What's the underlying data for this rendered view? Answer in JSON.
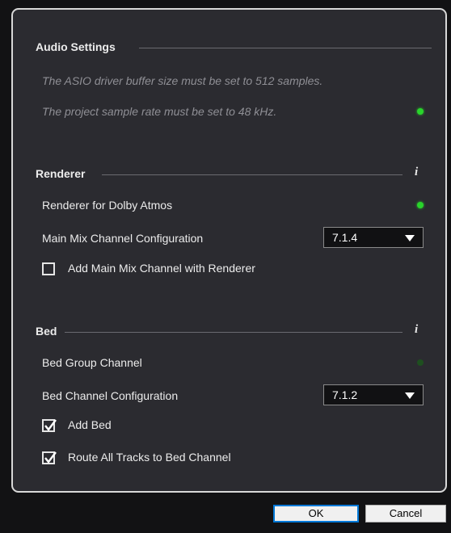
{
  "audio_settings": {
    "title": "Audio Settings",
    "note_buffer": "The ASIO driver buffer size must be set to 512 samples.",
    "note_sample_rate": "The project sample rate must be set to 48 kHz.",
    "sample_rate_status": "ok"
  },
  "renderer": {
    "title": "Renderer",
    "renderer_label": "Renderer for Dolby Atmos",
    "renderer_status": "ok",
    "main_mix_label": "Main Mix Channel Configuration",
    "main_mix_value": "7.1.4",
    "add_main_mix_label": "Add Main Mix Channel with Renderer",
    "add_main_mix_checked": false
  },
  "bed": {
    "title": "Bed",
    "group_channel_label": "Bed Group Channel",
    "group_channel_status": "inactive",
    "config_label": "Bed Channel Configuration",
    "config_value": "7.1.2",
    "add_bed_label": "Add Bed",
    "add_bed_checked": true,
    "route_label": "Route All Tracks to Bed Channel",
    "route_checked": true
  },
  "info_icon_glyph": "i",
  "footer": {
    "ok_label": "OK",
    "cancel_label": "Cancel"
  },
  "colors": {
    "led_on": "#29d42b",
    "led_off": "#1e4f1f",
    "panel_bg": "#2b2b30",
    "default_button_border": "#0078d7"
  }
}
